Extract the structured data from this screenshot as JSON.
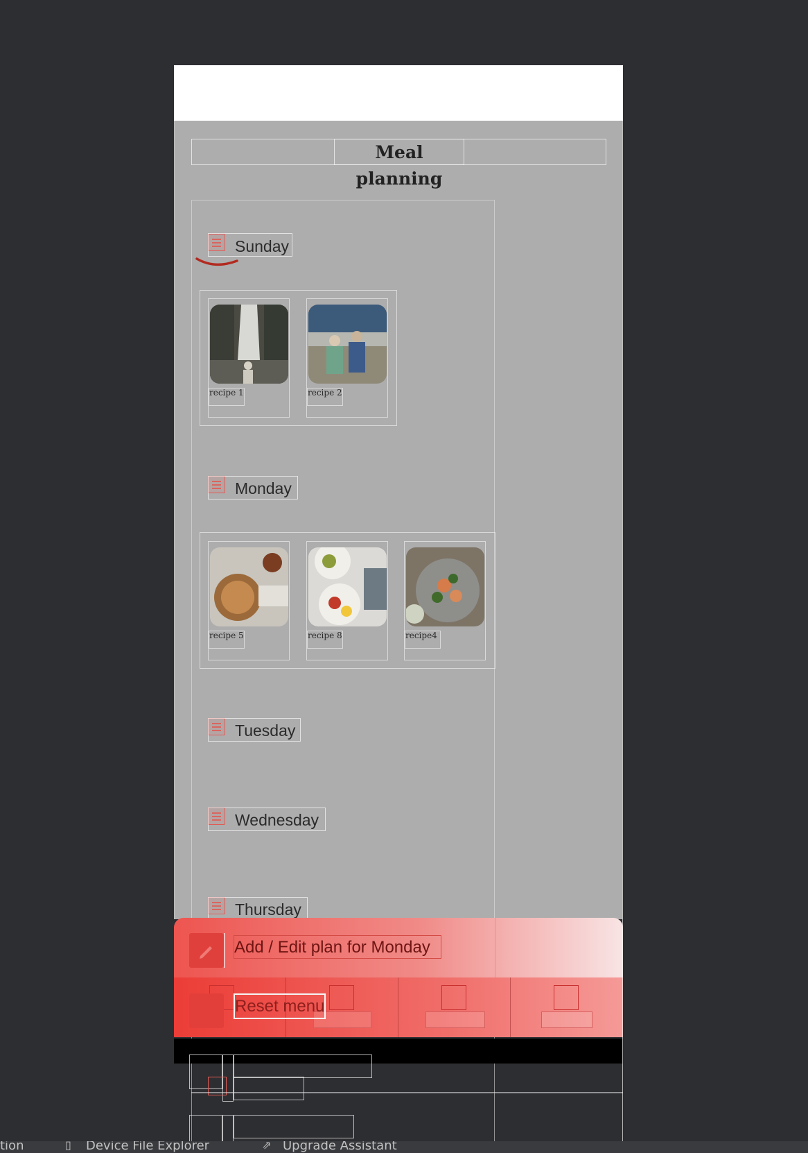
{
  "app": {
    "title": "Meal planning"
  },
  "days": [
    {
      "label": "Sunday",
      "recipes": [
        "recipe 1",
        "recipe 2"
      ]
    },
    {
      "label": "Monday",
      "recipes": [
        "recipe 5",
        "recipe 8",
        "recipe4"
      ]
    },
    {
      "label": "Tuesday",
      "recipes": []
    },
    {
      "label": "Wednesday",
      "recipes": []
    },
    {
      "label": "Thursday",
      "recipes": []
    }
  ],
  "actions": {
    "edit_label": "Add / Edit plan for Monday",
    "reset_label": "Reset menu"
  },
  "ide_status": {
    "item0": "tion",
    "item1": "Device File Explorer",
    "item2": "Upgrade Assistant"
  },
  "icons": {
    "day": "list-icon",
    "edit": "pencil-icon"
  },
  "colors": {
    "accent": "#ee4a45",
    "overlay": "#adadad",
    "background": "#2d2e31"
  }
}
